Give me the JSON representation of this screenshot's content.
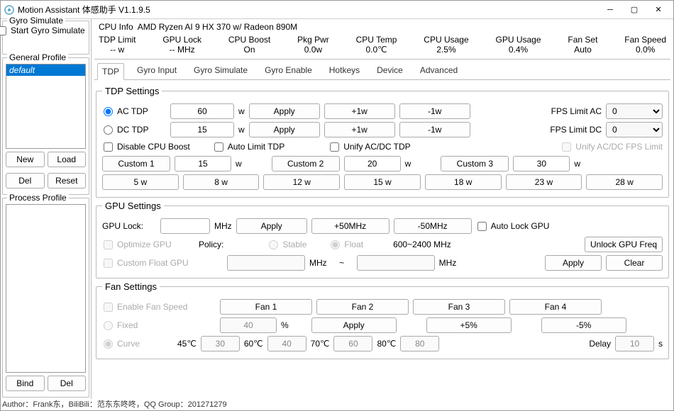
{
  "window": {
    "title": "Motion Assistant 体感助手 V1.1.9.5"
  },
  "left": {
    "gyro_panel": "Gyro Simulate",
    "start_gyro": "Start Gyro Simulate",
    "general_profile": "General Profile",
    "profile_default": "default",
    "btn_new": "New",
    "btn_load": "Load",
    "btn_del": "Del",
    "btn_reset": "Reset",
    "process_profile": "Process Profile",
    "btn_bind": "Bind",
    "btn_del2": "Del"
  },
  "header": {
    "cpu_info_label": "CPU Info",
    "cpu_info_value": "AMD Ryzen AI 9 HX 370 w/ Radeon 890M",
    "stats": [
      {
        "label": "TDP Limit",
        "value": "-- w"
      },
      {
        "label": "GPU Lock",
        "value": "-- MHz"
      },
      {
        "label": "CPU Boost",
        "value": "On"
      },
      {
        "label": "Pkg Pwr",
        "value": "0.0w"
      },
      {
        "label": "CPU Temp",
        "value": "0.0℃"
      },
      {
        "label": "CPU Usage",
        "value": "2.5%"
      },
      {
        "label": "GPU Usage",
        "value": "0.4%"
      },
      {
        "label": "Fan Set",
        "value": "Auto"
      },
      {
        "label": "Fan Speed",
        "value": "0.0%"
      }
    ]
  },
  "tabs": [
    "TDP",
    "Gyro Input",
    "Gyro Simulate",
    "Gyro Enable",
    "Hotkeys",
    "Device",
    "Advanced"
  ],
  "tdp": {
    "settings_title": "TDP Settings",
    "ac_tdp": "AC TDP",
    "ac_val": "60",
    "w": "w",
    "apply": "Apply",
    "plus1w": "+1w",
    "minus1w": "-1w",
    "fps_ac": "FPS Limit AC",
    "fps_ac_val": "0",
    "dc_tdp": "DC TDP",
    "dc_val": "15",
    "fps_dc": "FPS Limit DC",
    "fps_dc_val": "0",
    "disable_boost": "Disable CPU Boost",
    "auto_limit": "Auto Limit TDP",
    "unify_tdp": "Unify AC/DC TDP",
    "unify_fps": "Unify AC/DC FPS Limit",
    "custom1": "Custom 1",
    "c1": "15",
    "custom2": "Custom 2",
    "c2": "20",
    "custom3": "Custom 3",
    "c3": "30",
    "presets": [
      "5 w",
      "8 w",
      "12 w",
      "15 w",
      "18 w",
      "23 w",
      "28 w"
    ]
  },
  "gpu": {
    "title": "GPU Settings",
    "lock": "GPU Lock:",
    "mhz": "MHz",
    "apply": "Apply",
    "plus50": "+50MHz",
    "minus50": "-50MHz",
    "auto": "Auto Lock GPU",
    "optimize": "Optimize GPU",
    "policy": "Policy:",
    "stable": "Stable",
    "float": "Float",
    "range": "600~2400 MHz",
    "unlock": "Unlock GPU Freq",
    "custom_float": "Custom Float GPU",
    "tilde": "~",
    "clear": "Clear"
  },
  "fan": {
    "title": "Fan Settings",
    "enable": "Enable Fan Speed",
    "f1": "Fan 1",
    "f2": "Fan 2",
    "f3": "Fan 3",
    "f4": "Fan 4",
    "fixed": "Fixed",
    "fixed_val": "40",
    "pct": "%",
    "apply": "Apply",
    "plus5": "+5%",
    "minus5": "-5%",
    "curve": "Curve",
    "t1": "45℃",
    "v1": "30",
    "t2": "60℃",
    "v2": "40",
    "t3": "70℃",
    "v3": "60",
    "t4": "80℃",
    "v4": "80",
    "delay": "Delay",
    "dv": "10",
    "s": "s"
  },
  "footer": "Author：Frank东，BiliBili：范东东咚咚，QQ Group：201271279"
}
